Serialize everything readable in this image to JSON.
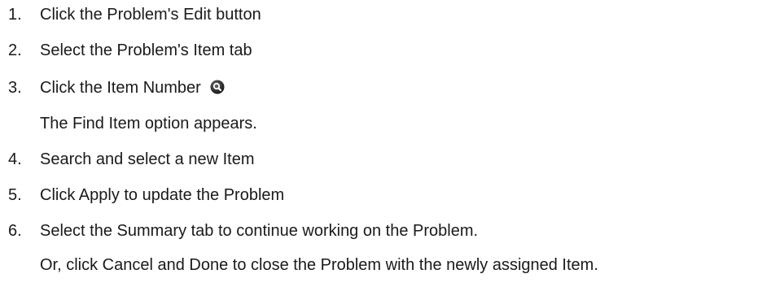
{
  "steps": [
    {
      "number": "1.",
      "text": "Click the Problem's Edit button"
    },
    {
      "number": "2.",
      "text": "Select the Problem's Item tab"
    },
    {
      "number": "3.",
      "text": "Click the Item Number",
      "icon": "search-icon",
      "note": "The Find Item option appears."
    },
    {
      "number": "4.",
      "text": "Search and select a new Item"
    },
    {
      "number": "5.",
      "text": "Click Apply to update the Problem"
    },
    {
      "number": "6.",
      "text": "Select the Summary tab to continue working on the Problem.",
      "note": "Or, click Cancel and Done to close the Problem with the newly assigned Item."
    }
  ]
}
